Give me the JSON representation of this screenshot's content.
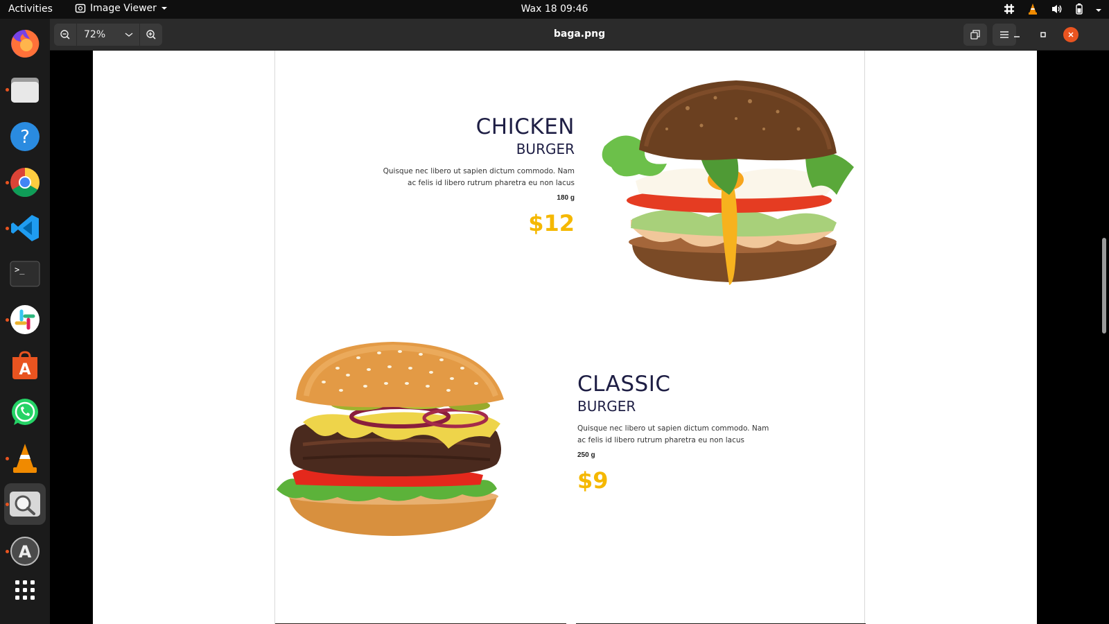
{
  "topbar": {
    "activities": "Activities",
    "app_name": "Image Viewer",
    "clock": "Wax 18  09:46"
  },
  "dock": {
    "items": [
      {
        "name": "firefox-icon",
        "running": false
      },
      {
        "name": "files-icon",
        "running": true
      },
      {
        "name": "help-icon",
        "running": false
      },
      {
        "name": "chrome-icon",
        "running": true
      },
      {
        "name": "vscode-icon",
        "running": true
      },
      {
        "name": "terminal-icon",
        "running": false
      },
      {
        "name": "slack-icon",
        "running": true
      },
      {
        "name": "app-center-icon",
        "running": false
      },
      {
        "name": "whatsapp-icon",
        "running": false
      },
      {
        "name": "vlc-icon",
        "running": true
      },
      {
        "name": "image-viewer-icon",
        "running": true,
        "active": true
      },
      {
        "name": "software-updater-icon",
        "running": true
      },
      {
        "name": "show-apps-icon",
        "running": false
      }
    ]
  },
  "viewer": {
    "zoom": "72%",
    "filename": "baga.png"
  },
  "menu": {
    "items": [
      {
        "title": "CHICKEN",
        "subtitle": "BURGER",
        "desc_line1": "Quisque nec libero ut sapien dictum commodo. Nam",
        "desc_line2": "ac felis id libero rutrum pharetra eu non lacus",
        "weight": "180 g",
        "price": "$12"
      },
      {
        "title": "CLASSIC",
        "subtitle": "BURGER",
        "desc_line1": "Quisque nec libero ut sapien dictum commodo. Nam",
        "desc_line2": "ac felis id libero rutrum pharetra eu non lacus",
        "weight": "250 g",
        "price": "$9"
      }
    ]
  },
  "colors": {
    "accent_price": "#f5b800",
    "title_navy": "#1e1e44",
    "close_button": "#e95420"
  }
}
